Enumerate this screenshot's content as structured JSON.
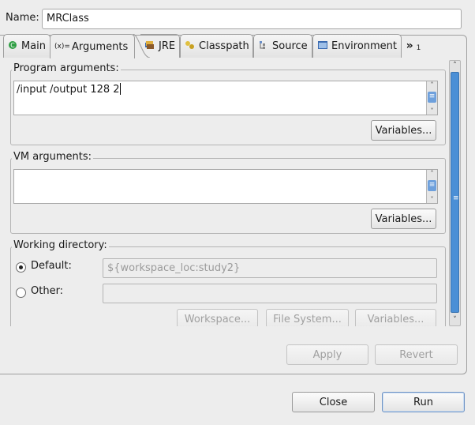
{
  "name": {
    "label": "Name:",
    "value": "MRClass"
  },
  "tabs": [
    {
      "label": "Main",
      "icon": "main-tab-icon"
    },
    {
      "label": "Arguments",
      "icon": "arguments-tab-icon",
      "active": true
    },
    {
      "label": "JRE",
      "icon": "jre-tab-icon"
    },
    {
      "label": "Classpath",
      "icon": "classpath-tab-icon"
    },
    {
      "label": "Source",
      "icon": "source-tab-icon"
    },
    {
      "label": "Environment",
      "icon": "environment-tab-icon"
    }
  ],
  "tab_overflow": {
    "glyph": "»",
    "count": "1"
  },
  "tab_icon_glyphs": {
    "arguments": "(x)="
  },
  "program_args": {
    "title": "Program arguments:",
    "value": "/input /output 128 2",
    "variables_label": "Variables..."
  },
  "vm_args": {
    "title": "VM arguments:",
    "value": "",
    "variables_label": "Variables..."
  },
  "working_dir": {
    "title": "Working directory:",
    "default_label": "Default:",
    "default_value": "${workspace_loc:study2}",
    "other_label": "Other:",
    "other_value": "",
    "selected": "default",
    "workspace_label": "Workspace...",
    "filesystem_label": "File System...",
    "variables_label": "Variables..."
  },
  "footer": {
    "apply_label": "Apply",
    "revert_label": "Revert",
    "close_label": "Close",
    "run_label": "Run"
  },
  "colors": {
    "scroll_thumb": "#4a8fd6",
    "disabled_text": "#a0a0a0"
  }
}
